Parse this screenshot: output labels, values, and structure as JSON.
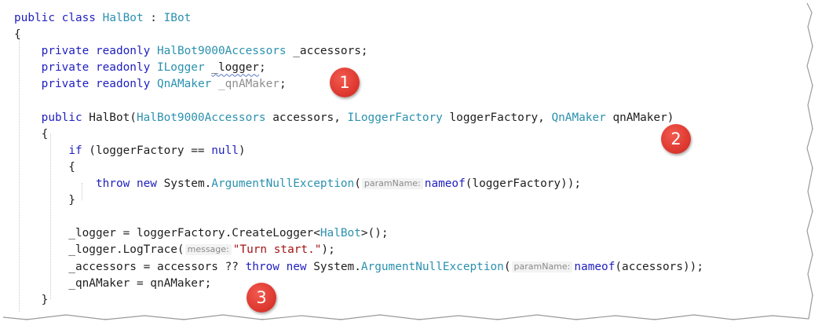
{
  "code_lines": [
    [
      [
        "kw",
        "public"
      ],
      [
        "id",
        " "
      ],
      [
        "kw",
        "class"
      ],
      [
        "id",
        " "
      ],
      [
        "ty",
        "HalBot"
      ],
      [
        "id",
        " : "
      ],
      [
        "ty",
        "IBot"
      ]
    ],
    [
      [
        "id",
        "{"
      ]
    ],
    [
      [
        "id",
        "    "
      ],
      [
        "kw",
        "private"
      ],
      [
        "id",
        " "
      ],
      [
        "kw",
        "readonly"
      ],
      [
        "id",
        " "
      ],
      [
        "ty",
        "HalBot9000Accessors"
      ],
      [
        "id",
        " _accessors;"
      ]
    ],
    [
      [
        "id",
        "    "
      ],
      [
        "kw",
        "private"
      ],
      [
        "id",
        " "
      ],
      [
        "kw",
        "readonly"
      ],
      [
        "id",
        " "
      ],
      [
        "ty",
        "ILogger"
      ],
      [
        "id",
        " "
      ],
      [
        "squig",
        "_logger"
      ],
      [
        "id",
        ";"
      ]
    ],
    [
      [
        "id",
        "    "
      ],
      [
        "kw",
        "private"
      ],
      [
        "id",
        " "
      ],
      [
        "kw",
        "readonly"
      ],
      [
        "id",
        " "
      ],
      [
        "ty",
        "QnAMaker"
      ],
      [
        "id",
        " "
      ],
      [
        "fade",
        "_qnAMaker"
      ],
      [
        "id",
        ";"
      ]
    ],
    [
      [
        "id",
        ""
      ]
    ],
    [
      [
        "id",
        "    "
      ],
      [
        "kw",
        "public"
      ],
      [
        "id",
        " HalBot("
      ],
      [
        "ty",
        "HalBot9000Accessors"
      ],
      [
        "id",
        " accessors, "
      ],
      [
        "ty",
        "ILoggerFactory"
      ],
      [
        "id",
        " loggerFactory, "
      ],
      [
        "ty",
        "QnAMaker"
      ],
      [
        "id",
        " qnAMaker)"
      ]
    ],
    [
      [
        "id",
        "    {"
      ]
    ],
    [
      [
        "id",
        "        "
      ],
      [
        "kw",
        "if"
      ],
      [
        "id",
        " (loggerFactory == "
      ],
      [
        "kw",
        "null"
      ],
      [
        "id",
        ")"
      ]
    ],
    [
      [
        "id",
        "        {"
      ]
    ],
    [
      [
        "id",
        "            "
      ],
      [
        "kw",
        "throw"
      ],
      [
        "id",
        " "
      ],
      [
        "kw",
        "new"
      ],
      [
        "id",
        " System."
      ],
      [
        "ty",
        "ArgumentNullException"
      ],
      [
        "id",
        "("
      ],
      [
        "hint",
        "paramName:"
      ],
      [
        "kw",
        "nameof"
      ],
      [
        "id",
        "(loggerFactory));"
      ]
    ],
    [
      [
        "id",
        "        }"
      ]
    ],
    [
      [
        "id",
        ""
      ]
    ],
    [
      [
        "id",
        "        _logger = loggerFactory.CreateLogger<"
      ],
      [
        "ty",
        "HalBot"
      ],
      [
        "id",
        ">();"
      ]
    ],
    [
      [
        "id",
        "        _logger.LogTrace("
      ],
      [
        "hint",
        "message:"
      ],
      [
        "str",
        "\"Turn start.\""
      ],
      [
        "id",
        ");"
      ]
    ],
    [
      [
        "id",
        "        _accessors = accessors ?? "
      ],
      [
        "kw",
        "throw"
      ],
      [
        "id",
        " "
      ],
      [
        "kw",
        "new"
      ],
      [
        "id",
        " System."
      ],
      [
        "ty",
        "ArgumentNullException"
      ],
      [
        "id",
        "("
      ],
      [
        "hint",
        "paramName:"
      ],
      [
        "kw",
        "nameof"
      ],
      [
        "id",
        "(accessors));"
      ]
    ],
    [
      [
        "id",
        "        _qnAMaker = qnAMaker;"
      ]
    ],
    [
      [
        "id",
        "    }"
      ]
    ]
  ],
  "callouts": [
    "1",
    "2",
    "3"
  ],
  "colors": {
    "keyword": "#1f1fbf",
    "type": "#2b91af",
    "string": "#a31515",
    "text": "#1e1e1e",
    "faded": "#8f8f8f",
    "badge": "#de3a31"
  }
}
